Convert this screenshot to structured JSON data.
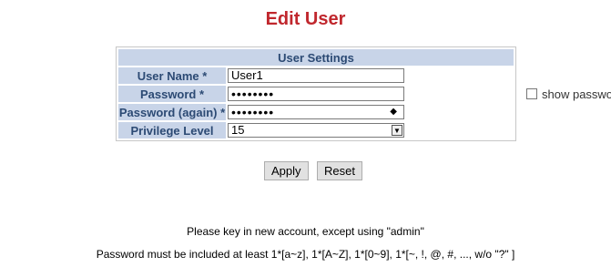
{
  "page": {
    "title": "Edit User"
  },
  "settings": {
    "header": "User Settings",
    "username_label": "User Name *",
    "username_value": "User1",
    "password_label": "Password *",
    "password_value": "••••••••",
    "show_password_label": "show password",
    "password_again_label": "Password (again) *",
    "password_again_value": "••••••••",
    "privilege_label": "Privilege Level",
    "privilege_value": "15"
  },
  "buttons": {
    "apply": "Apply",
    "reset": "Reset"
  },
  "notes": {
    "line1": "Please key in new account, except using \"admin\"",
    "line2": "Password must be included at least 1*[a~z], 1*[A~Z], 1*[0~9], 1*[~, !, @, #, ..., w/o \"?\" ]"
  }
}
